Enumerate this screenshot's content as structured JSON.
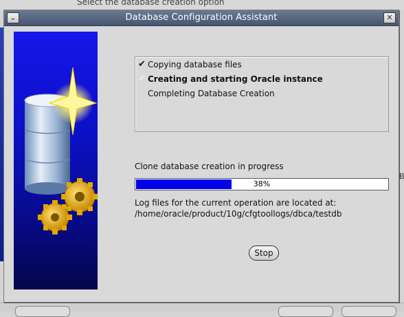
{
  "background": {
    "top_text": "Select the database creation option",
    "right_text": "B"
  },
  "window": {
    "title": "Database Configuration Assistant",
    "menu_icon": "chevron-down-icon",
    "close_icon": "close-icon"
  },
  "steps": [
    {
      "label": "Copying database files",
      "mark": "✔",
      "state": "done"
    },
    {
      "label": "Creating and starting Oracle instance",
      "mark": "✔",
      "state": "current"
    },
    {
      "label": "Completing Database Creation",
      "mark": "",
      "state": "pending"
    }
  ],
  "status": {
    "label": "Clone database creation in progress",
    "progress_percent": 38,
    "progress_text": "38%",
    "bar_color": "#0000e8"
  },
  "log": {
    "line1": "Log files for the current operation are located at:",
    "line2": "/home/oracle/product/10g/cfgtoollogs/dbca/testdb"
  },
  "buttons": {
    "stop": "Stop"
  }
}
